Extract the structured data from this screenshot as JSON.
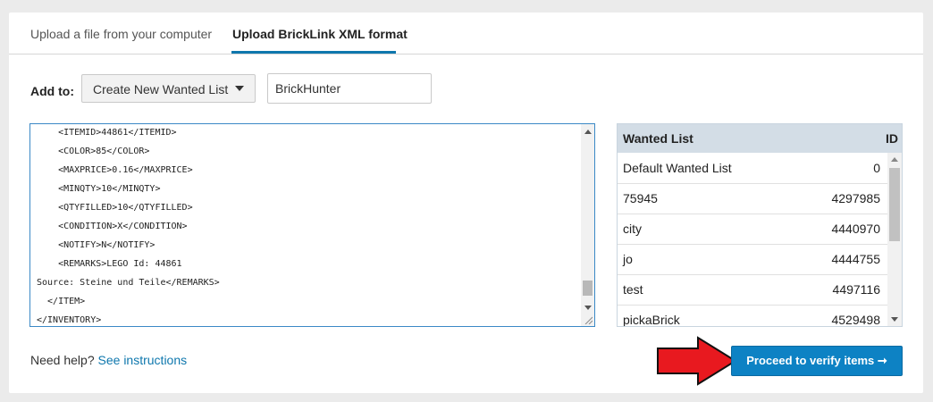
{
  "tabs": [
    {
      "label": "Upload a file from your computer",
      "active": false
    },
    {
      "label": "Upload BrickLink XML format",
      "active": true
    }
  ],
  "add_to": {
    "label": "Add to:",
    "select_value": "Create New Wanted List",
    "name_value": "BrickHunter"
  },
  "xml_lines": [
    "    <ITEMID>44861</ITEMID>",
    "    <COLOR>85</COLOR>",
    "    <MAXPRICE>0.16</MAXPRICE>",
    "    <MINQTY>10</MINQTY>",
    "    <QTYFILLED>10</QTYFILLED>",
    "    <CONDITION>X</CONDITION>",
    "    <NOTIFY>N</NOTIFY>",
    "    <REMARKS>LEGO Id: 44861",
    "Source: Steine und Teile</REMARKS>",
    "  </ITEM>",
    "</INVENTORY>"
  ],
  "wanted_table": {
    "headers": [
      "Wanted List",
      "ID"
    ],
    "rows": [
      {
        "name": "Default Wanted List",
        "id": "0"
      },
      {
        "name": "75945",
        "id": "4297985"
      },
      {
        "name": "city",
        "id": "4440970"
      },
      {
        "name": "jo",
        "id": "4444755"
      },
      {
        "name": "test",
        "id": "4497116"
      },
      {
        "name": "pickaBrick",
        "id": "4529498"
      }
    ]
  },
  "help": {
    "text": "Need help?",
    "link": "See instructions"
  },
  "proceed_label": "Proceed to verify items ➞",
  "colors": {
    "accent": "#0e77ad",
    "button": "#0d82c4",
    "arrow": "#e8191f"
  }
}
